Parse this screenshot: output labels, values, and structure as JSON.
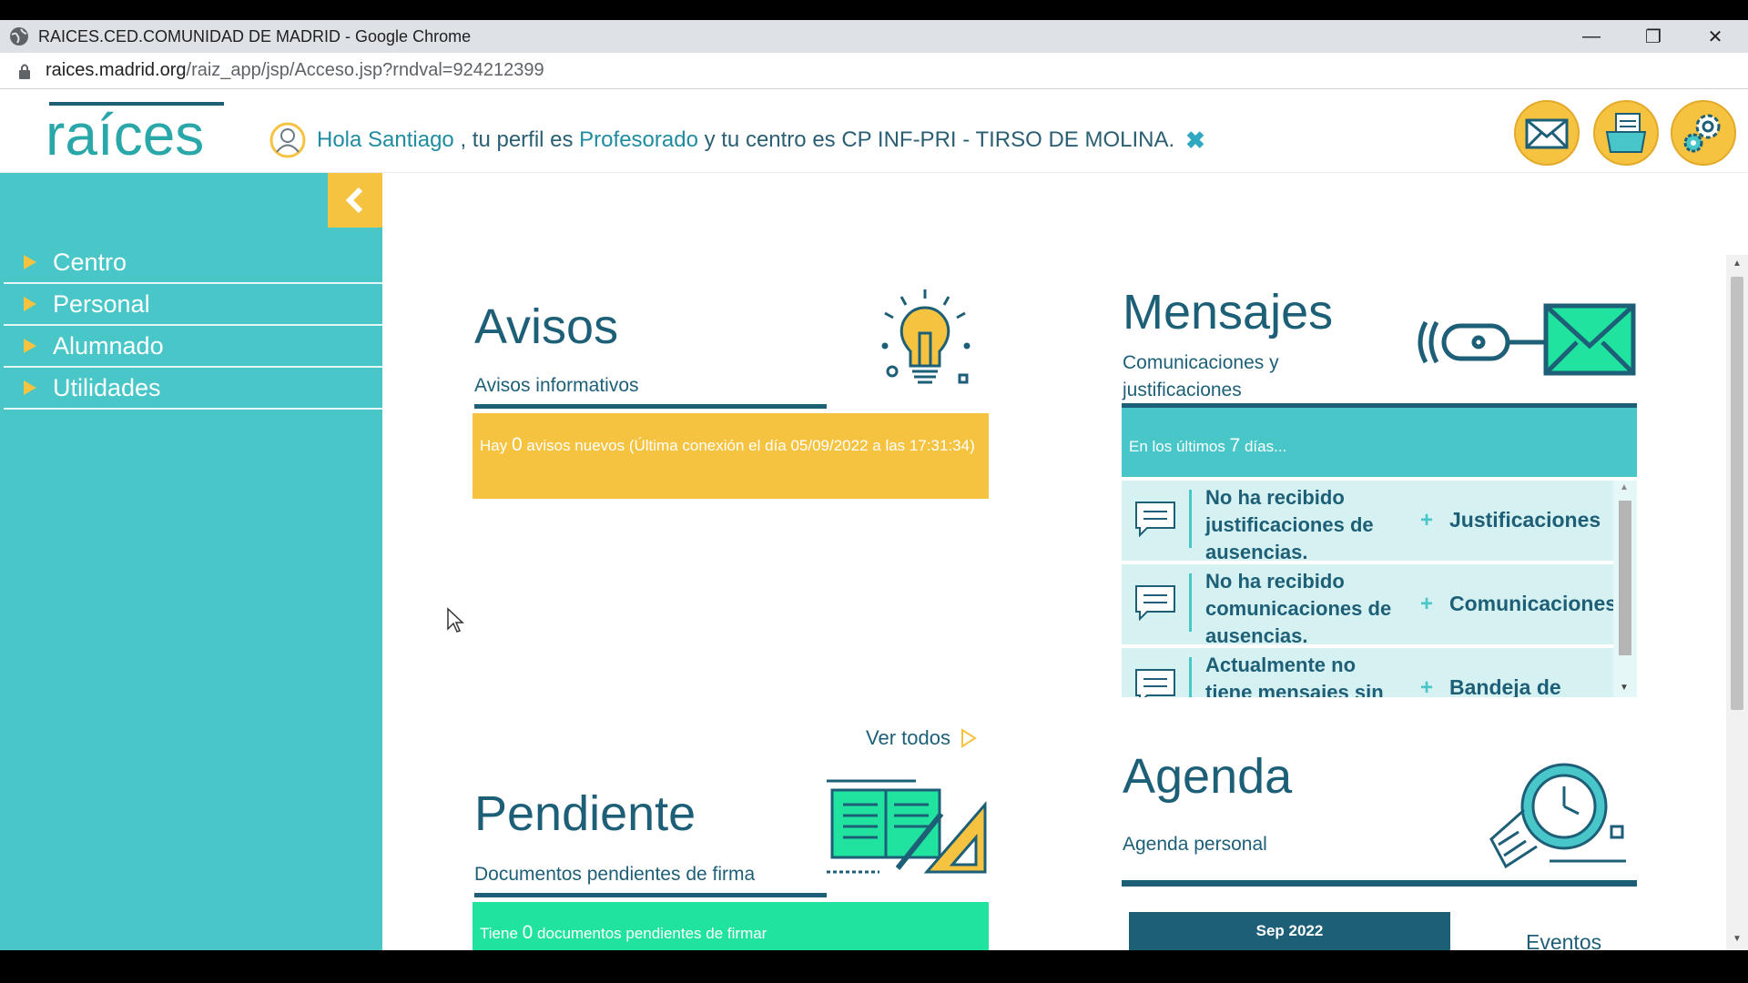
{
  "browser": {
    "window_title": "RAICES.CED.COMUNIDAD DE MADRID - Google Chrome",
    "url_host": "raices.madrid.org",
    "url_path": "/raiz_app/jsp/Acceso.jsp?rndval=924212399",
    "minimize": "—",
    "restore": "❐",
    "close": "✕"
  },
  "header": {
    "logo_text": "raíces",
    "greeting_hello": "Hola Santiago",
    "greeting_part1": " , tu perfil es ",
    "profile": "Profesorado",
    "greeting_part2": " y tu centro es CP INF-PRI - TIRSO DE MOLINA.",
    "dismiss": "✖"
  },
  "sidebar": {
    "collapse_icon": "chevron-left-icon",
    "items": [
      {
        "label": "Centro"
      },
      {
        "label": "Personal"
      },
      {
        "label": "Alumnado"
      },
      {
        "label": "Utilidades"
      }
    ]
  },
  "avisos": {
    "title": "Avisos",
    "subtitle": "Avisos informativos",
    "notice_pre": "Hay ",
    "notice_count": "0",
    "notice_post": " avisos nuevos (Última conexión el día 05/09/2022 a las 17:31:34)",
    "ver_todos": "Ver todos",
    "box_color": "#f6c341"
  },
  "mensajes": {
    "title": "Mensajes",
    "subtitle": "Comunicaciones y justificaciones",
    "period_pre": "En los últimos ",
    "period_count": "7",
    "period_post": " días...",
    "rows": [
      {
        "text": "No ha recibido justificaciones de ausencias.",
        "action": "Justificaciones"
      },
      {
        "text": "No ha recibido comunicaciones de ausencias.",
        "action": "Comunicaciones"
      },
      {
        "text": "Actualmente no tiene mensajes sin",
        "action": "Bandeja de"
      }
    ]
  },
  "pendiente": {
    "title": "Pendiente",
    "subtitle": "Documentos pendientes de firma",
    "notice_pre": "Tiene ",
    "notice_count": "0",
    "notice_post": " documentos pendientes de firmar",
    "box_color": "#20e3a0"
  },
  "agenda": {
    "title": "Agenda",
    "subtitle": "Agenda personal",
    "month": "Sep 2022",
    "events_label": "Eventos"
  },
  "colors": {
    "teal": "#48c6c8",
    "dark_teal": "#1d5f77",
    "yellow": "#f6c341",
    "green": "#20e3a0"
  }
}
